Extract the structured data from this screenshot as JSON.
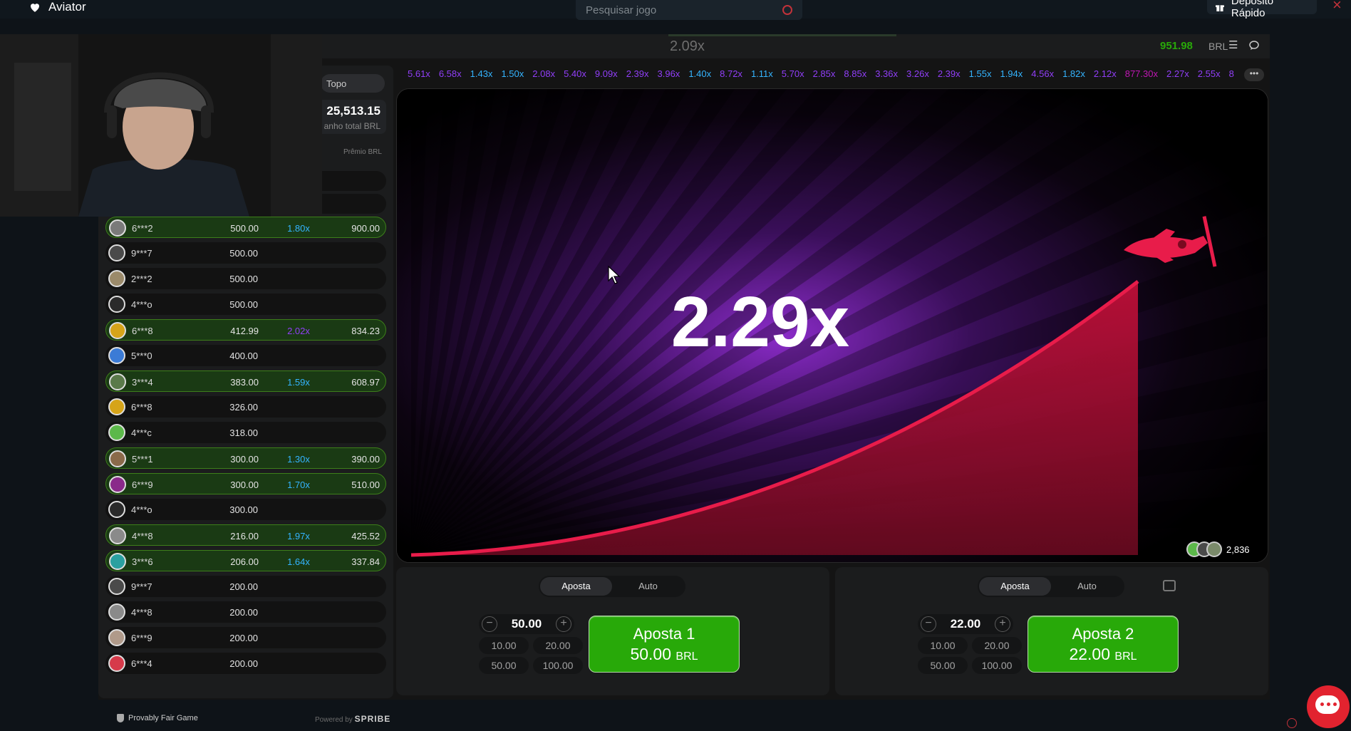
{
  "top_bar": {
    "brand": "Aviator",
    "search_placeholder": "Pesquisar jogo",
    "deposit_label": "Depósito Rápido"
  },
  "header": {
    "last_multiplier": "2.09x",
    "balance": "951.98",
    "currency": "BRL"
  },
  "history": [
    {
      "v": "5.61x",
      "c": "#913ef8"
    },
    {
      "v": "6.58x",
      "c": "#913ef8"
    },
    {
      "v": "1.43x",
      "c": "#34b4ff"
    },
    {
      "v": "1.50x",
      "c": "#34b4ff"
    },
    {
      "v": "2.08x",
      "c": "#913ef8"
    },
    {
      "v": "5.40x",
      "c": "#913ef8"
    },
    {
      "v": "9.09x",
      "c": "#913ef8"
    },
    {
      "v": "2.39x",
      "c": "#913ef8"
    },
    {
      "v": "3.96x",
      "c": "#913ef8"
    },
    {
      "v": "1.40x",
      "c": "#34b4ff"
    },
    {
      "v": "8.72x",
      "c": "#913ef8"
    },
    {
      "v": "1.11x",
      "c": "#34b4ff"
    },
    {
      "v": "5.70x",
      "c": "#913ef8"
    },
    {
      "v": "2.85x",
      "c": "#913ef8"
    },
    {
      "v": "8.85x",
      "c": "#913ef8"
    },
    {
      "v": "3.36x",
      "c": "#913ef8"
    },
    {
      "v": "3.26x",
      "c": "#913ef8"
    },
    {
      "v": "2.39x",
      "c": "#913ef8"
    },
    {
      "v": "1.55x",
      "c": "#34b4ff"
    },
    {
      "v": "1.94x",
      "c": "#34b4ff"
    },
    {
      "v": "4.56x",
      "c": "#913ef8"
    },
    {
      "v": "1.82x",
      "c": "#34b4ff"
    },
    {
      "v": "2.12x",
      "c": "#913ef8"
    },
    {
      "v": "877.30x",
      "c": "#c017b4"
    },
    {
      "v": "2.27x",
      "c": "#913ef8"
    },
    {
      "v": "2.55x",
      "c": "#913ef8"
    },
    {
      "v": "8",
      "c": "#913ef8"
    }
  ],
  "left_panel": {
    "tab_top": "Topo",
    "total_value": "25,513.15",
    "total_label": "anho total BRL",
    "col_prize": "Prêmio BRL",
    "rows": [
      {
        "name": "6***2",
        "bet": "500.00",
        "mult": "1.80x",
        "win": "900.00",
        "won": true,
        "mc": "#34b4ff",
        "av": "#7a7a7a"
      },
      {
        "name": "9***7",
        "bet": "500.00",
        "mult": "",
        "win": "",
        "won": false,
        "mc": "",
        "av": "#4a4a4a"
      },
      {
        "name": "2***2",
        "bet": "500.00",
        "mult": "",
        "win": "",
        "won": false,
        "mc": "",
        "av": "#9b8a6a"
      },
      {
        "name": "4***o",
        "bet": "500.00",
        "mult": "",
        "win": "",
        "won": false,
        "mc": "",
        "av": "#2a2a2a"
      },
      {
        "name": "6***8",
        "bet": "412.99",
        "mult": "2.02x",
        "win": "834.23",
        "won": true,
        "mc": "#913ef8",
        "av": "#d6a419"
      },
      {
        "name": "5***0",
        "bet": "400.00",
        "mult": "",
        "win": "",
        "won": false,
        "mc": "",
        "av": "#3b7bd6"
      },
      {
        "name": "3***4",
        "bet": "383.00",
        "mult": "1.59x",
        "win": "608.97",
        "won": true,
        "mc": "#34b4ff",
        "av": "#5a7a4a"
      },
      {
        "name": "6***8",
        "bet": "326.00",
        "mult": "",
        "win": "",
        "won": false,
        "mc": "",
        "av": "#d6a419"
      },
      {
        "name": "4***c",
        "bet": "318.00",
        "mult": "",
        "win": "",
        "won": false,
        "mc": "",
        "av": "#5cb84a"
      },
      {
        "name": "5***1",
        "bet": "300.00",
        "mult": "1.30x",
        "win": "390.00",
        "won": true,
        "mc": "#34b4ff",
        "av": "#8a6a4a"
      },
      {
        "name": "6***9",
        "bet": "300.00",
        "mult": "1.70x",
        "win": "510.00",
        "won": true,
        "mc": "#34b4ff",
        "av": "#8a2a8a"
      },
      {
        "name": "4***o",
        "bet": "300.00",
        "mult": "",
        "win": "",
        "won": false,
        "mc": "",
        "av": "#2a2a2a"
      },
      {
        "name": "4***8",
        "bet": "216.00",
        "mult": "1.97x",
        "win": "425.52",
        "won": true,
        "mc": "#34b4ff",
        "av": "#8a8a8a"
      },
      {
        "name": "3***6",
        "bet": "206.00",
        "mult": "1.64x",
        "win": "337.84",
        "won": true,
        "mc": "#34b4ff",
        "av": "#2aa0a0"
      },
      {
        "name": "9***7",
        "bet": "200.00",
        "mult": "",
        "win": "",
        "won": false,
        "mc": "",
        "av": "#4a4a4a"
      },
      {
        "name": "4***8",
        "bet": "200.00",
        "mult": "",
        "win": "",
        "won": false,
        "mc": "",
        "av": "#8a8a8a"
      },
      {
        "name": "6***9",
        "bet": "200.00",
        "mult": "",
        "win": "",
        "won": false,
        "mc": "",
        "av": "#b09a8a"
      },
      {
        "name": "6***4",
        "bet": "200.00",
        "mult": "",
        "win": "",
        "won": false,
        "mc": "",
        "av": "#d63a4a"
      }
    ],
    "footer_fair": "Provably Fair Game",
    "footer_powered": "Powered by",
    "footer_brand": "SPRIBE"
  },
  "game": {
    "multiplier": "2.29x",
    "player_count": "2,836"
  },
  "bet1": {
    "tab_bet": "Aposta",
    "tab_auto": "Auto",
    "amount": "50.00",
    "quick": [
      "10.00",
      "20.00",
      "50.00",
      "100.00"
    ],
    "btn_line1": "Aposta 1",
    "btn_amount": "50.00",
    "btn_currency": "BRL"
  },
  "bet2": {
    "tab_bet": "Aposta",
    "tab_auto": "Auto",
    "amount": "22.00",
    "quick": [
      "10.00",
      "20.00",
      "50.00",
      "100.00"
    ],
    "btn_line1": "Aposta 2",
    "btn_amount": "22.00",
    "btn_currency": "BRL"
  }
}
